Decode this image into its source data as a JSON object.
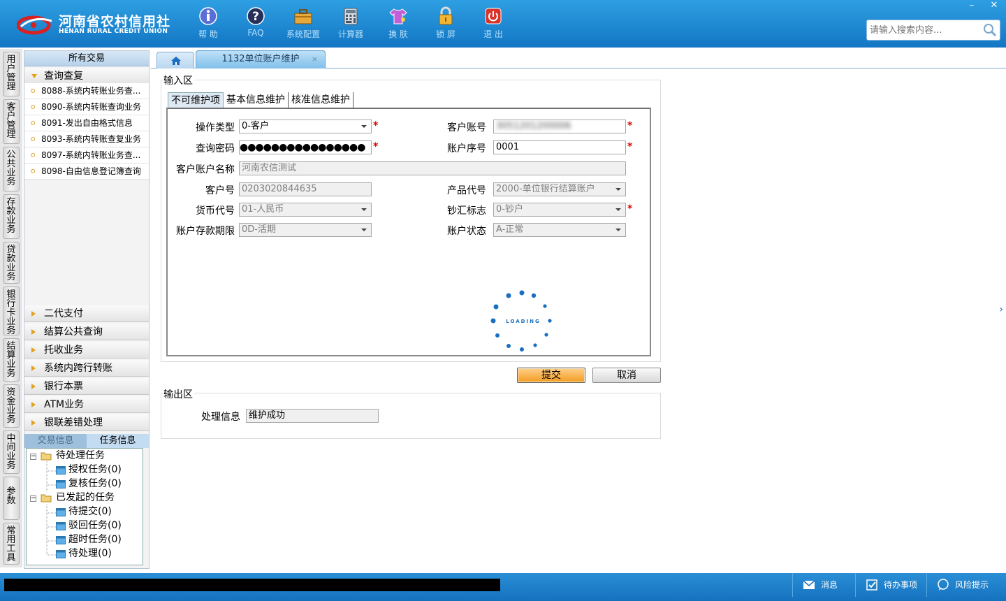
{
  "header": {
    "logo_cn": "河南省农村信用社",
    "logo_en": "HENAN RURAL CREDIT UNION",
    "nav": [
      {
        "label": "帮 助",
        "icon": "info-icon"
      },
      {
        "label": "FAQ",
        "icon": "question-icon"
      },
      {
        "label": "系统配置",
        "icon": "toolbox-icon"
      },
      {
        "label": "计算器",
        "icon": "calculator-icon"
      },
      {
        "label": "换 肤",
        "icon": "shirt-icon"
      },
      {
        "label": "锁 屏",
        "icon": "lock-icon"
      },
      {
        "label": "退 出",
        "icon": "power-icon"
      }
    ],
    "search_placeholder": "请输入搜索内容...",
    "win_min": "–",
    "win_close": "✕"
  },
  "vtabs": [
    "用户管理",
    "客户管理",
    "公共业务",
    "存款业务",
    "贷款业务",
    "银行卡业务",
    "结算业务",
    "资金业务",
    "中间业务",
    "参数",
    "常用工具"
  ],
  "leftpanel": {
    "title": "所有交易",
    "expanded": "查询查复",
    "items": [
      "8088-系统内转账业务查...",
      "8090-系统内转账查询业务",
      "8091-发出自由格式信息",
      "8093-系统内转账查复业务",
      "8097-系统内转账业务查...",
      "8098-自由信息登记簿查询"
    ],
    "collapsed": [
      "二代支付",
      "结算公共查询",
      "托收业务",
      "系统内跨行转账",
      "银行本票",
      "ATM业务",
      "银联差错处理"
    ],
    "mini_tabs": [
      "交易信息",
      "任务信息"
    ],
    "tree": {
      "pending": "待处理任务",
      "pending_children": [
        "授权任务(0)",
        "复核任务(0)"
      ],
      "started": "已发起的任务",
      "started_children": [
        "待提交(0)",
        "驳回任务(0)",
        "超时任务(0)",
        "待处理(0)"
      ]
    }
  },
  "main": {
    "tab_title": "1132单位账户维护",
    "tab_close": "×",
    "input_label": "输入区",
    "inner_tabs": [
      "不可维护项",
      "基本信息维护",
      "核准信息维护"
    ],
    "fields": {
      "op_type_label": "操作类型",
      "op_type_value": "0-客户",
      "cust_account_label": "客户账号",
      "cust_account_value": "3051201200006",
      "password_label": "查询密码",
      "password_value": "●●●●●●●●●●●●●●●●",
      "account_seq_label": "账户序号",
      "account_seq_value": "0001",
      "account_name_label": "客户账户名称",
      "account_name_value": "河南农信测试",
      "cust_no_label": "客户号",
      "cust_no_value": "0203020844635",
      "product_label": "产品代号",
      "product_value": "2000-单位银行结算账户",
      "currency_label": "货币代号",
      "currency_value": "01-人民币",
      "cash_flag_label": "钞汇标志",
      "cash_flag_value": "0-钞户",
      "term_label": "账户存款期限",
      "term_value": "0D-活期",
      "status_label": "账户状态",
      "status_value": "A-正常"
    },
    "required_mark": "*",
    "loading_text": "LOADING",
    "submit": "提交",
    "cancel": "取消",
    "output_label": "输出区",
    "process_label": "处理信息",
    "process_value": "维护成功",
    "right_handle": "›"
  },
  "statusbar": {
    "items": [
      {
        "label": "消息",
        "icon": "mail-icon"
      },
      {
        "label": "待办事项",
        "icon": "checkbox-icon"
      },
      {
        "label": "风险提示",
        "icon": "chat-bubble-icon"
      }
    ]
  },
  "colors": {
    "header_blue": "#1f8ad6",
    "accent_orange": "#f39a1e",
    "required_red": "#dd0000"
  }
}
